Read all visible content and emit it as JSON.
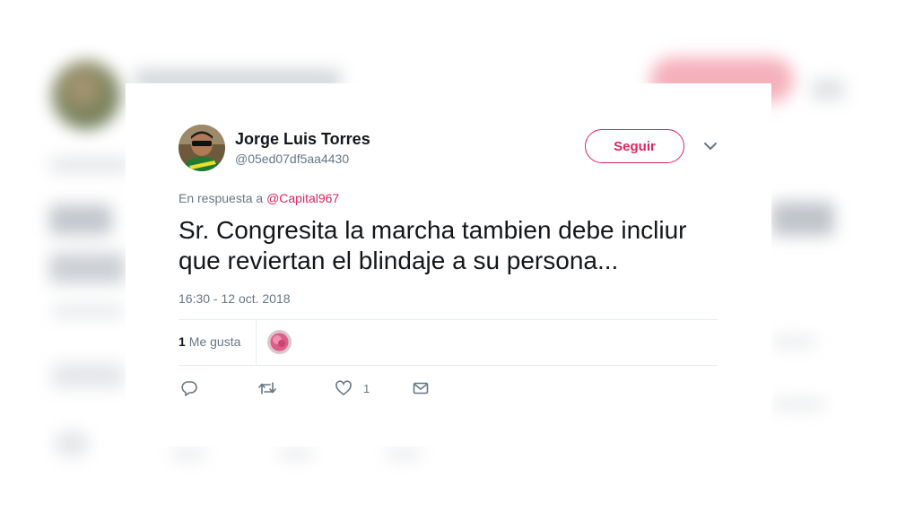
{
  "tweet": {
    "author_name": "Jorge Luis Torres",
    "author_handle": "@05ed07df5aa4430",
    "follow_label": "Seguir",
    "reply_prefix": "En respuesta a",
    "reply_mention": "@Capital967",
    "text": "Sr. Congresita la marcha tambien debe incliur que reviertan el blindaje a su persona...",
    "timestamp": "16:30 - 12 oct. 2018",
    "likes_count": "1",
    "likes_label": "Me gusta"
  },
  "actions": {
    "like_count": "1"
  },
  "icons": {
    "menu": "chevron-down-icon",
    "reply": "reply-icon",
    "retweet": "retweet-icon",
    "like": "heart-icon",
    "message": "envelope-icon"
  },
  "colors": {
    "accent": "#e0245e",
    "text_primary": "#14171a",
    "text_secondary": "#657786",
    "divider": "#e6ecf0"
  }
}
